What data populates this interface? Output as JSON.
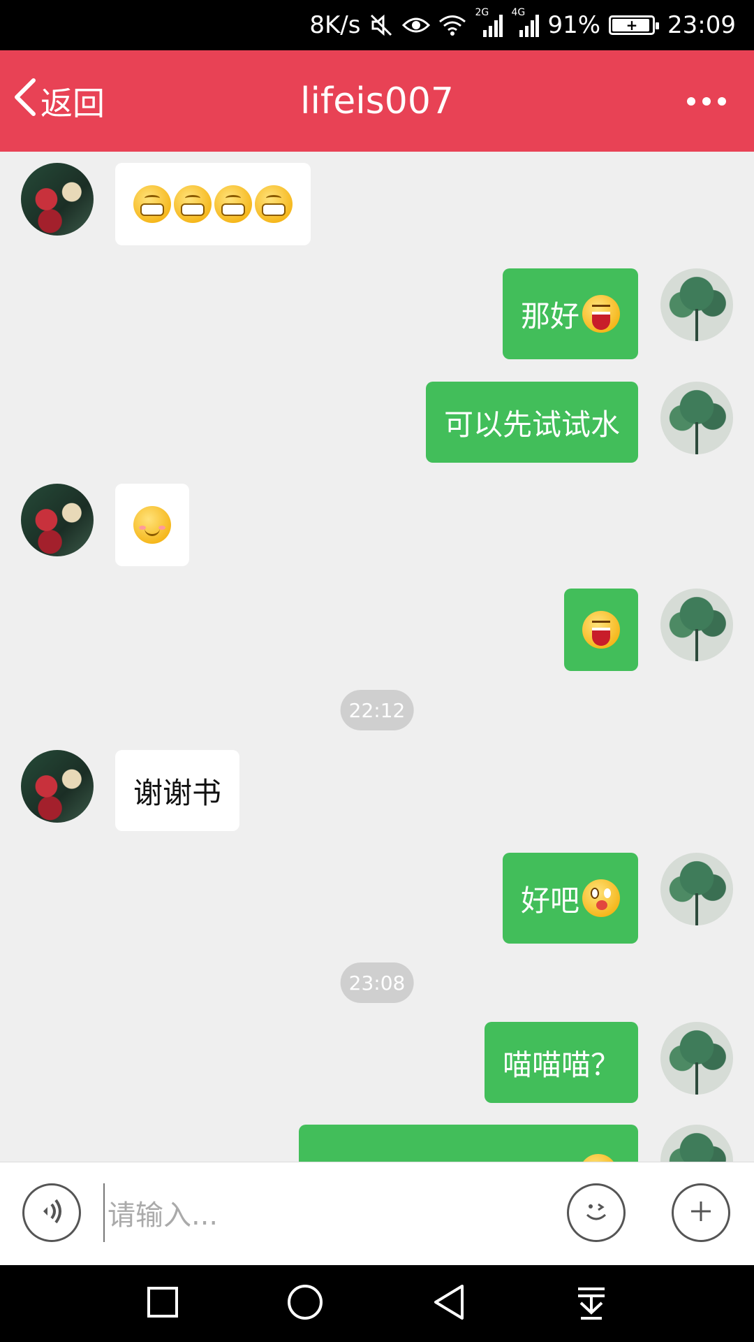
{
  "status_bar": {
    "net_speed": "8K/s",
    "sim1": "2G",
    "sim2": "4G",
    "battery": "91%",
    "time": "23:09",
    "icons": [
      "mute-icon",
      "eye-icon",
      "wifi-icon",
      "signal-icon",
      "battery-icon"
    ]
  },
  "header": {
    "back_label": "返回",
    "title": "lifeis007",
    "more_icon": "more-icon"
  },
  "messages": [
    {
      "side": "left",
      "text": "",
      "emojis": [
        "grin",
        "grin",
        "grin",
        "grin"
      ]
    },
    {
      "side": "right",
      "text": "那好",
      "emojis": [
        "laugh"
      ]
    },
    {
      "side": "right",
      "text": "可以先试试水",
      "emojis": []
    },
    {
      "side": "left",
      "text": "",
      "emojis": [
        "smile"
      ]
    },
    {
      "side": "right",
      "text": "",
      "emojis": [
        "laugh"
      ]
    },
    {
      "side": "time",
      "text": "22:12"
    },
    {
      "side": "left",
      "text": "谢谢书",
      "emojis": []
    },
    {
      "side": "right",
      "text": "好吧",
      "emojis": [
        "tongue"
      ]
    },
    {
      "side": "time",
      "text": "23:08"
    },
    {
      "side": "right",
      "text": "喵喵喵？",
      "emojis": []
    },
    {
      "side": "right",
      "text": "",
      "emojis": []
    }
  ],
  "input_bar": {
    "placeholder": "请输入...",
    "voice_icon": "voice-icon",
    "emoji_icon": "emoji-icon",
    "plus_icon": "plus-icon"
  },
  "colors": {
    "header": "#e84255",
    "bubble_right": "#42be5a",
    "bubble_left": "#ffffff",
    "background": "#efefef"
  }
}
